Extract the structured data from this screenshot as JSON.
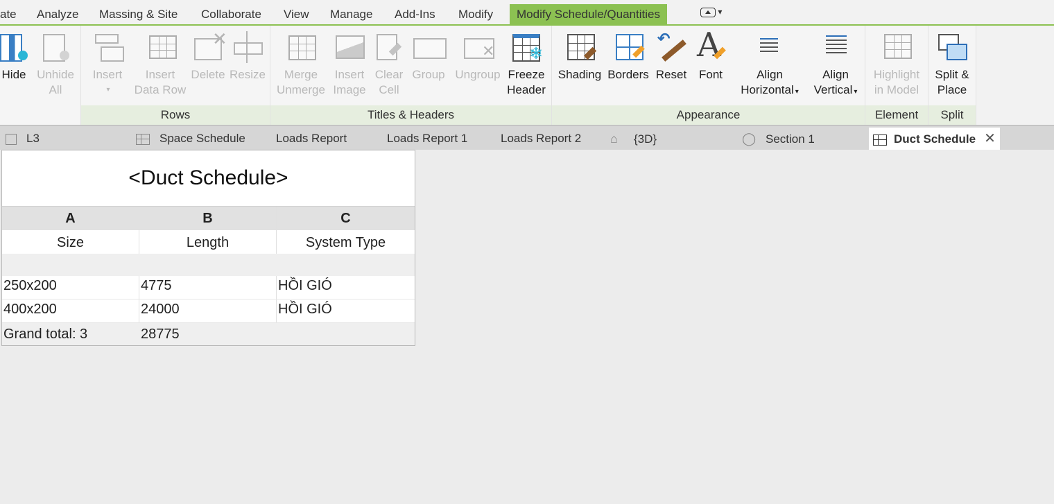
{
  "menu": {
    "tabs": [
      "ate",
      "Analyze",
      "Massing & Site",
      "Collaborate",
      "View",
      "Manage",
      "Add-Ins",
      "Modify"
    ],
    "active_tab": "Modify Schedule/Quantities"
  },
  "ribbon": {
    "panels": {
      "rows": "Rows",
      "titles_headers": "Titles & Headers",
      "appearance": "Appearance",
      "element": "Element",
      "split": "Split"
    },
    "buttons": {
      "hide": "Hide",
      "unhide_all": [
        "Unhide",
        "All"
      ],
      "insert": "Insert",
      "insert_data_row": [
        "Insert",
        "Data Row"
      ],
      "delete": "Delete",
      "resize": "Resize",
      "merge_unmerge": [
        "Merge",
        "Unmerge"
      ],
      "insert_image": [
        "Insert",
        "Image"
      ],
      "clear_cell": [
        "Clear",
        "Cell"
      ],
      "group": "Group",
      "ungroup": "Ungroup",
      "freeze_header": [
        "Freeze",
        "Header"
      ],
      "shading": "Shading",
      "borders": "Borders",
      "reset": "Reset",
      "font": "Font",
      "align_horizontal": [
        "Align",
        "Horizontal"
      ],
      "align_vertical": [
        "Align",
        "Vertical"
      ],
      "highlight_in_model": [
        "Highlight",
        "in Model"
      ],
      "split_place": [
        "Split &",
        "Place"
      ]
    }
  },
  "view_tabs": [
    "L3",
    "Space Schedule",
    "Loads Report",
    "Loads Report 1",
    "Loads Report 2",
    "{3D}",
    "Section 1",
    "Duct Schedule"
  ],
  "schedule": {
    "title": "<Duct Schedule>",
    "column_letters": [
      "A",
      "B",
      "C"
    ],
    "column_names": [
      "Size",
      "Length",
      "System Type"
    ],
    "rows": [
      [
        "250x200",
        "4775",
        "HỒI GIÓ"
      ],
      [
        "400x200",
        "24000",
        "HỒI GIÓ"
      ]
    ],
    "grand_total": {
      "label": "Grand total: 3",
      "length": "28775"
    }
  },
  "colors": {
    "accent_green": "#8cc152",
    "panel_label_bg": "#e6eedf",
    "canvas_bg": "#ececec"
  }
}
